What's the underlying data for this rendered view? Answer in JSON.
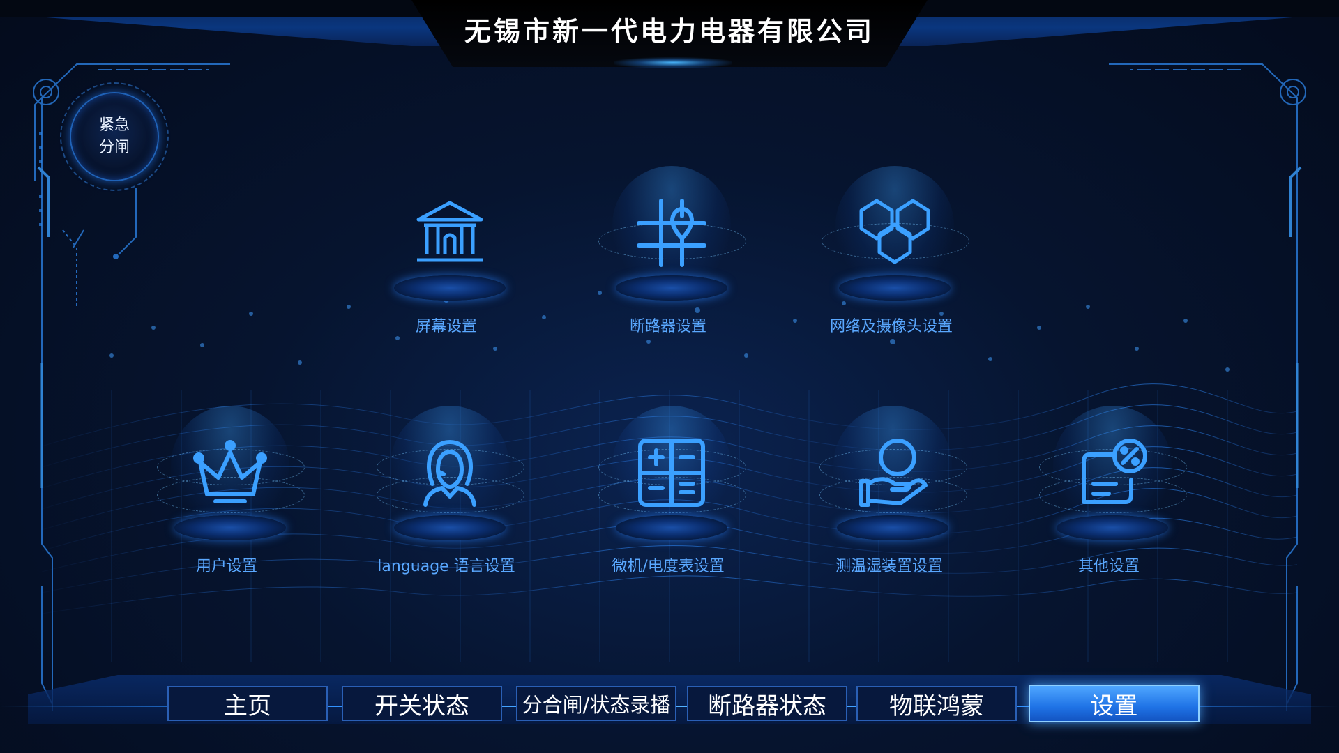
{
  "header": {
    "title": "无锡市新一代电力电器有限公司"
  },
  "emergency": {
    "line1": "紧急",
    "line2": "分闸"
  },
  "settings": {
    "row1": [
      {
        "label": "屏幕设置",
        "icon": "bank-building-icon"
      },
      {
        "label": "断路器设置",
        "icon": "crosshair-pin-icon"
      },
      {
        "label": "网络及摄像头设置",
        "icon": "hexagon-network-icon"
      }
    ],
    "row2": [
      {
        "label": "用户设置",
        "icon": "crown-icon"
      },
      {
        "label": "language 语言设置",
        "icon": "person-headset-icon"
      },
      {
        "label": "微机/电度表设置",
        "icon": "calculator-icon"
      },
      {
        "label": "测温湿装置设置",
        "icon": "hand-coin-icon"
      },
      {
        "label": "其他设置",
        "icon": "percent-document-icon"
      }
    ]
  },
  "nav": {
    "items": [
      "主页",
      "开关状态",
      "分合闸/状态录播",
      "断路器状态",
      "物联鸿蒙",
      "设置"
    ],
    "active_index": 5
  },
  "colors": {
    "accent": "#3b9cff",
    "label": "#5aa8ff",
    "background": "#06142f"
  }
}
